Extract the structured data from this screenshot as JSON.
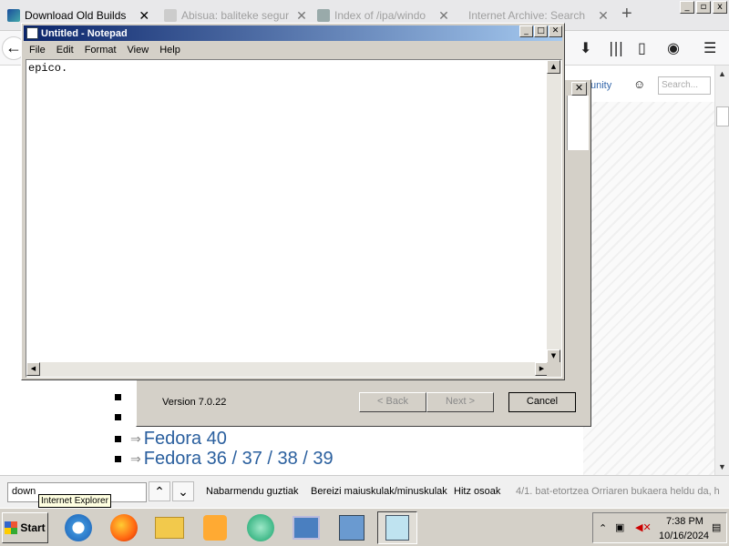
{
  "browser": {
    "tabs": [
      {
        "title": "Download Old Builds",
        "active": true
      },
      {
        "title": "Abisua: baliteke segur",
        "active": false
      },
      {
        "title": "Index of /ipa/windo",
        "active": false
      },
      {
        "title": "Internet Archive: Search",
        "active": false
      }
    ],
    "new_tab": "+",
    "back": "←",
    "toolbar_icons": [
      "download-icon",
      "library-icon",
      "sidebar-icon",
      "account-icon",
      "menu-icon"
    ],
    "window_controls": [
      "_",
      "▫",
      "x"
    ]
  },
  "website": {
    "nav_partial": "unity",
    "search_placeholder": "Search...",
    "list": [
      "",
      "",
      "Fedora 40",
      "Fedora 36 / 37 / 38 / 39"
    ]
  },
  "wizard": {
    "version": "Version 7.0.22",
    "back_label": "< Back",
    "next_label": "Next >",
    "cancel_label": "Cancel"
  },
  "notepad": {
    "title": "Untitled - Notepad",
    "menu": [
      "File",
      "Edit",
      "Format",
      "View",
      "Help"
    ],
    "content": "epico."
  },
  "findbar": {
    "query": "down",
    "highlight_all": "Nabarmendu guztiak",
    "match_case": "Bereizi maiuskulak/minuskulak",
    "whole_words": "Hitz osoak",
    "status": "4/1. bat-etortzea    Orriaren bukaera heldu da, h"
  },
  "tooltip": "Internet Explorer",
  "taskbar": {
    "start_label": "Start",
    "time": "7:38 PM",
    "date": "10/16/2024"
  }
}
